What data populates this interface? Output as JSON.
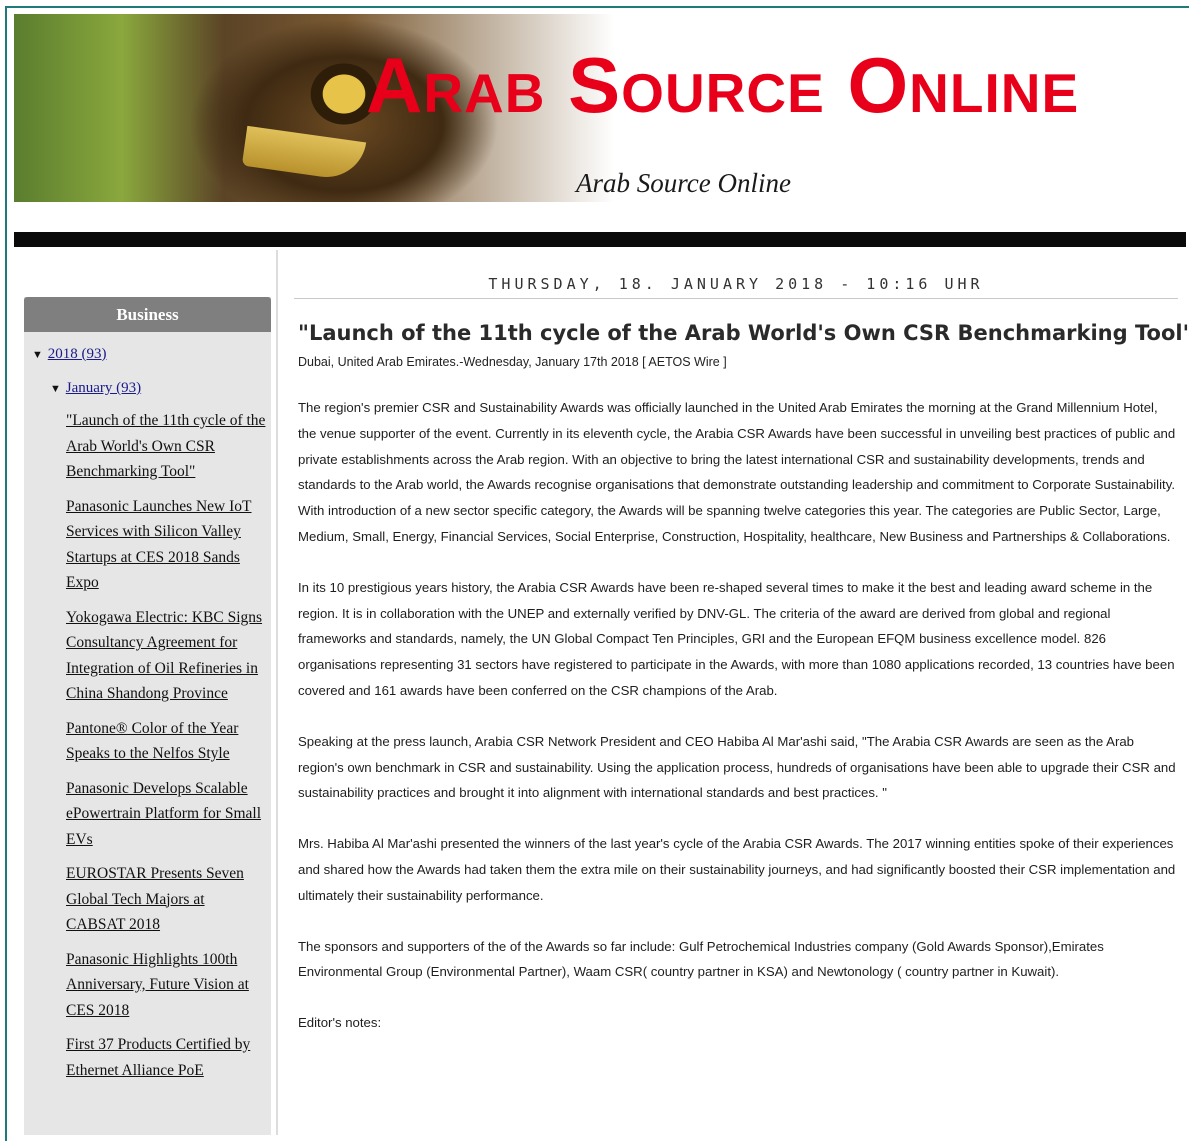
{
  "header": {
    "title": "Arab Source Online",
    "subtitle": "Arab Source Online"
  },
  "sidebar": {
    "heading": "Business",
    "year": "2018 (93)",
    "month": "January (93)",
    "posts": [
      "\"Launch of the 11th cycle of the Arab World's Own CSR Benchmarking Tool\"",
      "Panasonic Launches New IoT Services with Silicon Valley Startups at CES 2018 Sands Expo",
      "Yokogawa Electric: KBC Signs Consultancy Agreement for Integration of Oil Refineries in China Shandong Province",
      "Pantone® Color of the Year Speaks to the Nelfos Style",
      "Panasonic Develops Scalable ePowertrain Platform for Small EVs",
      "EUROSTAR Presents Seven Global Tech Majors at CABSAT 2018",
      "Panasonic Highlights 100th Anniversary, Future Vision at CES 2018",
      "First 37 Products Certified by Ethernet Alliance PoE"
    ]
  },
  "main": {
    "date": "THURSDAY, 18. JANUARY 2018 - 10:16 UHR",
    "post_title": "\"Launch of the 11th cycle of the Arab World's Own CSR Benchmarking Tool\"",
    "dateline": "Dubai, United Arab Emirates.-Wednesday, January 17th 2018 [ AETOS Wire ]",
    "paragraphs": [
      "The region's premier CSR and Sustainability Awards was officially launched in the United Arab Emirates the morning at the Grand Millennium Hotel, the venue supporter of the event. Currently in its eleventh cycle, the Arabia CSR Awards have been successful in unveiling best practices of public and private establishments across the Arab region. With an objective to bring the latest international CSR and sustainability developments, trends and standards to the Arab world, the Awards recognise organisations that demonstrate outstanding leadership and commitment to Corporate Sustainability. With introduction of a new sector specific category, the Awards will be spanning twelve categories this year. The categories are Public Sector, Large, Medium, Small, Energy, Financial Services, Social Enterprise, Construction, Hospitality, healthcare, New Business and Partnerships & Collaborations.",
      "In its 10 prestigious years history, the Arabia CSR Awards have been re-shaped several times to make it the best and leading award scheme in the region.  It is in collaboration with the UNEP and externally verified by DNV-GL.  The criteria of the award are derived from global and regional frameworks and standards, namely, the UN Global Compact Ten Principles, GRI and the European EFQM business excellence model. 826 organisations representing 31 sectors have registered to participate in the Awards, with more than 1080 applications recorded, 13 countries have been covered and 161 awards have been conferred on the CSR champions of the Arab.",
      "Speaking at the press launch, Arabia CSR Network President and CEO Habiba Al Mar'ashi said, \"The Arabia CSR Awards are seen as the Arab region's own benchmark in CSR and sustainability. Using the application process, hundreds of organisations have been able to upgrade their CSR and sustainability practices and brought it into alignment with international standards and best practices. \"",
      "Mrs. Habiba Al Mar'ashi presented the winners of the last year's cycle of the Arabia CSR Awards. The 2017 winning entities spoke of their experiences and shared how the Awards had taken them the extra mile on their sustainability journeys, and had significantly boosted their CSR implementation and ultimately their sustainability performance.",
      "The sponsors and supporters of the of the Awards so far include: Gulf Petrochemical Industries company (Gold Awards Sponsor),Emirates Environmental Group (Environmental Partner), Waam CSR( country partner in KSA) and Newtonology ( country partner in Kuwait).",
      "Editor's notes:"
    ]
  }
}
